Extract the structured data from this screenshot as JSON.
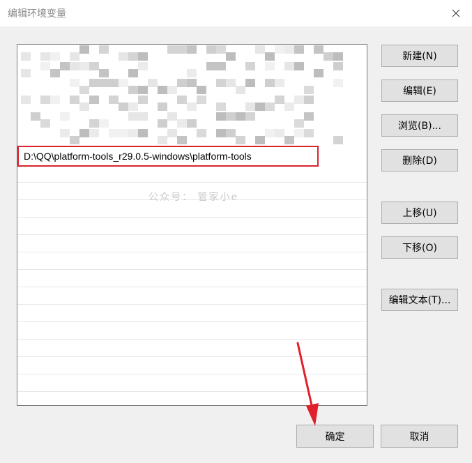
{
  "window": {
    "title": "编辑环境变量"
  },
  "list": {
    "selected_value": "D:\\QQ\\platform-tools_r29.0.5-windows\\platform-tools",
    "watermark": "公众号： 管家小e"
  },
  "buttons": {
    "new": "新建(N)",
    "edit": "编辑(E)",
    "browse": "浏览(B)...",
    "delete": "删除(D)",
    "move_up": "上移(U)",
    "move_down": "下移(O)",
    "edit_text": "编辑文本(T)...",
    "ok": "确定",
    "cancel": "取消"
  },
  "colors": {
    "highlight_border": "#d9232d",
    "arrow": "#e0202a"
  },
  "icons": {
    "close": "close-icon",
    "arrow": "arrow-annotation"
  }
}
